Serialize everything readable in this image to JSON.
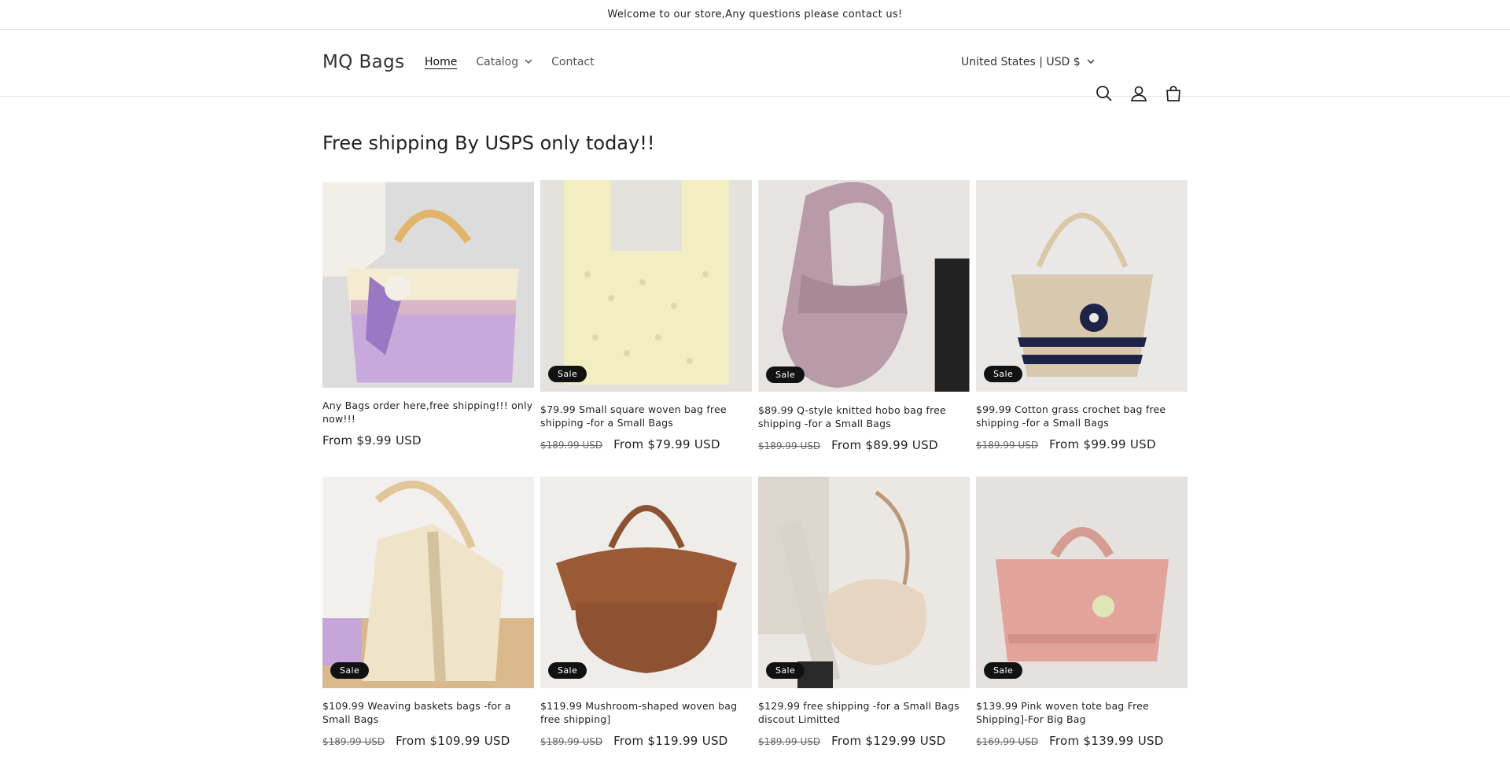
{
  "announcement": "Welcome to our store,Any questions please contact us!",
  "header": {
    "logo": "MQ Bags",
    "nav": [
      {
        "label": "Home"
      },
      {
        "label": "Catalog"
      },
      {
        "label": "Contact"
      }
    ],
    "country": "United States | USD $",
    "icons": [
      "search-icon",
      "account-icon",
      "cart-icon"
    ]
  },
  "collection": {
    "heading": "Free shipping By USPS only today!!",
    "products": [
      {
        "title": "Any Bags order here,free shipping!!! only now!!!",
        "old_price": "",
        "price": "From $9.99 USD",
        "sale": false,
        "sale_label": ""
      },
      {
        "title": "  $79.99 Small square woven bag free shipping   -for a Small Bags",
        "old_price": "$189.99 USD",
        "price": "From $79.99 USD",
        "sale": true,
        "sale_label": "Sale"
      },
      {
        "title": "  $89.99 Q-style knitted hobo bag free shipping   -for a Small Bags",
        "old_price": "$189.99 USD",
        "price": "From $89.99 USD",
        "sale": true,
        "sale_label": "Sale"
      },
      {
        "title": "  $99.99 Cotton grass crochet bag free shipping    -for a Small Bags",
        "old_price": "$189.99 USD",
        "price": "From $99.99 USD",
        "sale": true,
        "sale_label": "Sale"
      },
      {
        "title": "  $109.99 Weaving baskets bags    -for a Small Bags",
        "old_price": "$189.99 USD",
        "price": "From $109.99 USD",
        "sale": true,
        "sale_label": "Sale"
      },
      {
        "title": "  $119.99 Mushroom-shaped woven bag free shipping]",
        "old_price": "$189.99 USD",
        "price": "From $119.99 USD",
        "sale": true,
        "sale_label": "Sale"
      },
      {
        "title": "  $129.99 free shipping   -for a Small Bags discout Limitted",
        "old_price": "$189.99 USD",
        "price": "From $129.99 USD",
        "sale": true,
        "sale_label": "Sale"
      },
      {
        "title": "  $139.99 Pink woven tote bag Free Shipping]-For Big Bag",
        "old_price": "$169.99 USD",
        "price": "From $139.99 USD",
        "sale": true,
        "sale_label": "Sale"
      }
    ]
  }
}
